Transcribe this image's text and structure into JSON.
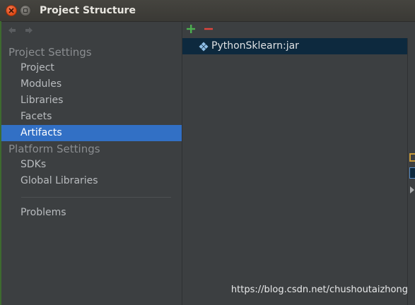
{
  "window": {
    "title": "Project Structure"
  },
  "colors": {
    "selection_bg": "#3270c5",
    "artifact_row_bg": "#0d293e",
    "add_icon": "#4caf50",
    "remove_icon": "#e0453c",
    "close_button": "#dd4814"
  },
  "icons": {
    "back": "arrow-left-icon",
    "forward": "arrow-right-icon",
    "add": "plus-icon",
    "remove": "minus-icon",
    "artifact": "artifact-jar-icon"
  },
  "sidebar": {
    "project_settings_header": "Project Settings",
    "platform_settings_header": "Platform Settings",
    "items": [
      {
        "label": "Project"
      },
      {
        "label": "Modules"
      },
      {
        "label": "Libraries"
      },
      {
        "label": "Facets"
      },
      {
        "label": "Artifacts"
      },
      {
        "label": "SDKs"
      },
      {
        "label": "Global Libraries"
      },
      {
        "label": "Problems"
      }
    ],
    "selected": "Artifacts"
  },
  "main": {
    "artifacts": [
      {
        "name": "PythonSklearn:jar"
      }
    ]
  },
  "watermark": "https://blog.csdn.net/chushoutaizhong"
}
